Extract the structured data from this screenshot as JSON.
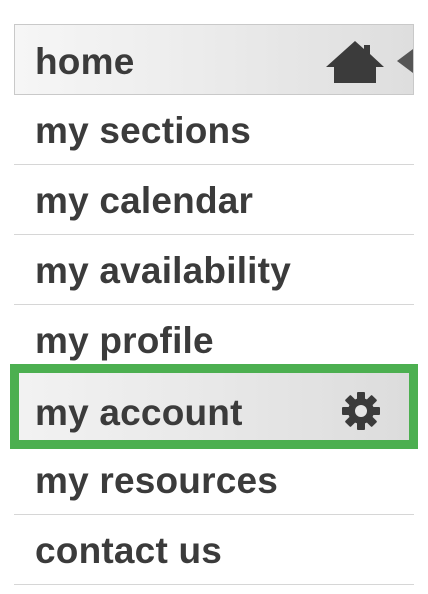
{
  "menu": {
    "items": [
      {
        "label": "home",
        "icon": "home-icon",
        "active": true
      },
      {
        "label": "my sections"
      },
      {
        "label": "my calendar"
      },
      {
        "label": "my availability"
      },
      {
        "label": "my profile"
      },
      {
        "label": "my account",
        "icon": "gear-icon",
        "highlighted": true
      },
      {
        "label": "my resources"
      },
      {
        "label": "contact us"
      }
    ]
  },
  "colors": {
    "text": "#3b3b3b",
    "highlight_border": "#4caf50",
    "divider": "#d6d6d6"
  }
}
